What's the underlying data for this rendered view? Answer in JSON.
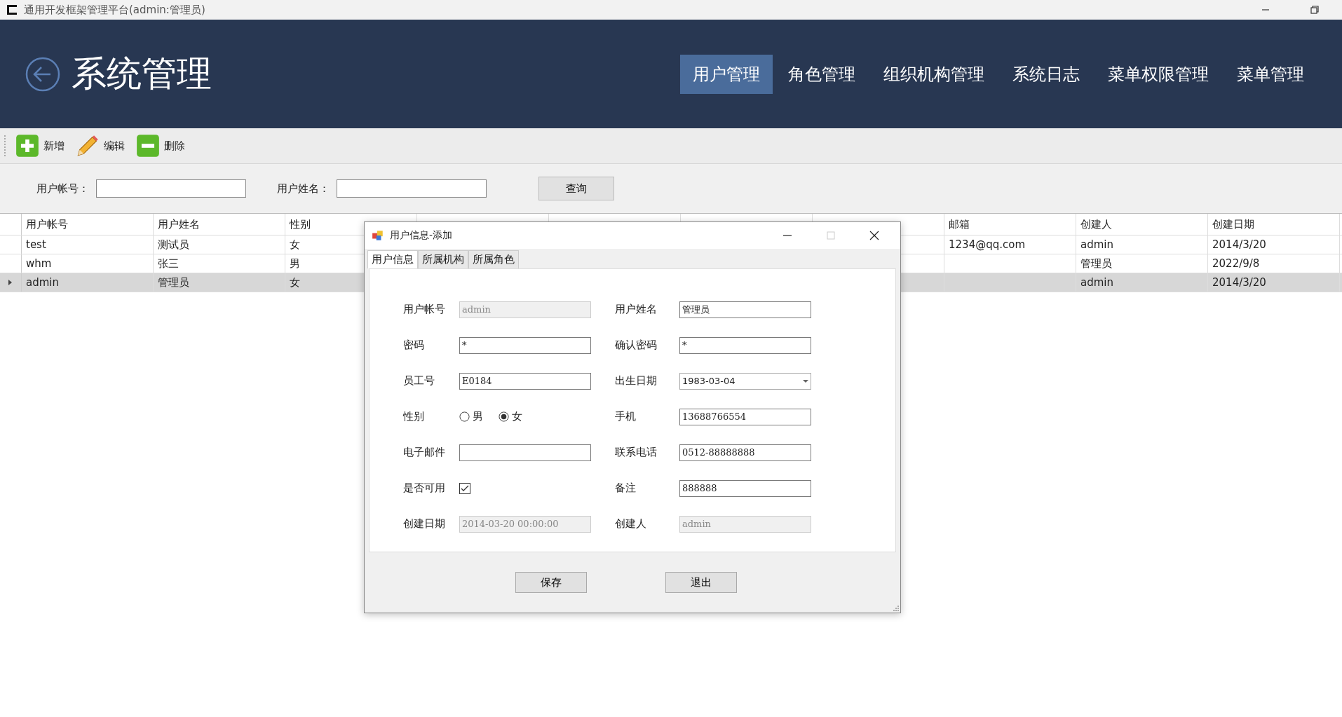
{
  "window": {
    "title": "通用开发框架管理平台(admin:管理员)"
  },
  "header": {
    "title": "系统管理",
    "nav": [
      {
        "label": "用户管理",
        "selected": true
      },
      {
        "label": "角色管理",
        "selected": false
      },
      {
        "label": "组织机构管理",
        "selected": false
      },
      {
        "label": "系统日志",
        "selected": false
      },
      {
        "label": "菜单权限管理",
        "selected": false
      },
      {
        "label": "菜单管理",
        "selected": false
      }
    ]
  },
  "toolbar": [
    {
      "kind": "add",
      "label": "新增"
    },
    {
      "kind": "edit",
      "label": "编辑"
    },
    {
      "kind": "delete",
      "label": "删除"
    }
  ],
  "search": {
    "fields": [
      {
        "label": "用户帐号："
      },
      {
        "label": "用户姓名："
      }
    ],
    "button": "查询"
  },
  "table": {
    "columns": [
      "用户帐号",
      "用户姓名",
      "性别",
      "邮箱",
      "创建人",
      "创建日期"
    ],
    "rows": [
      {
        "selected": false,
        "cells": [
          "test",
          "测试员",
          "女",
          "1234@qq.com",
          "admin",
          "2014/3/20"
        ]
      },
      {
        "selected": false,
        "cells": [
          "whm",
          "张三",
          "男",
          null,
          "管理员",
          "2022/9/8"
        ]
      },
      {
        "selected": true,
        "cells": [
          "admin",
          "管理员",
          "女",
          null,
          "admin",
          "2014/3/20"
        ]
      }
    ]
  },
  "dialog": {
    "title": "用户信息-添加",
    "tabs": [
      {
        "label": "用户信息",
        "selected": true
      },
      {
        "label": "所属机构",
        "selected": false
      },
      {
        "label": "所属角色",
        "selected": false
      }
    ],
    "fields": [
      {
        "kind": "text",
        "label": "用户帐号",
        "value": "admin",
        "disabled": true
      },
      {
        "kind": "text",
        "label": "用户姓名",
        "value": "管理员",
        "disabled": false
      },
      {
        "kind": "text",
        "label": "密码",
        "value": "*",
        "disabled": false
      },
      {
        "kind": "text",
        "label": "确认密码",
        "value": "*",
        "disabled": false
      },
      {
        "kind": "text",
        "label": "员工号",
        "value": "E0184",
        "disabled": false
      },
      {
        "kind": "date",
        "label": "出生日期",
        "value": "1983-03-04"
      },
      {
        "kind": "radio",
        "label": "性别",
        "options": [
          {
            "label": "男",
            "selected": false
          },
          {
            "label": "女",
            "selected": true
          }
        ]
      },
      {
        "kind": "text",
        "label": "手机",
        "value": "13688766554",
        "disabled": false
      },
      {
        "kind": "text",
        "label": "电子邮件",
        "disabled": false
      },
      {
        "kind": "text",
        "label": "联系电话",
        "value": "0512-88888888",
        "disabled": false
      },
      {
        "kind": "checkbox",
        "label": "是否可用",
        "checked": true
      },
      {
        "kind": "text",
        "label": "备注",
        "value": "888888",
        "disabled": false
      },
      {
        "kind": "text",
        "label": "创建日期",
        "value": "2014-03-20 00:00:00",
        "disabled": true
      },
      {
        "kind": "text",
        "label": "创建人",
        "value": "admin",
        "disabled": true
      }
    ],
    "buttons": [
      "保存",
      "退出"
    ]
  }
}
